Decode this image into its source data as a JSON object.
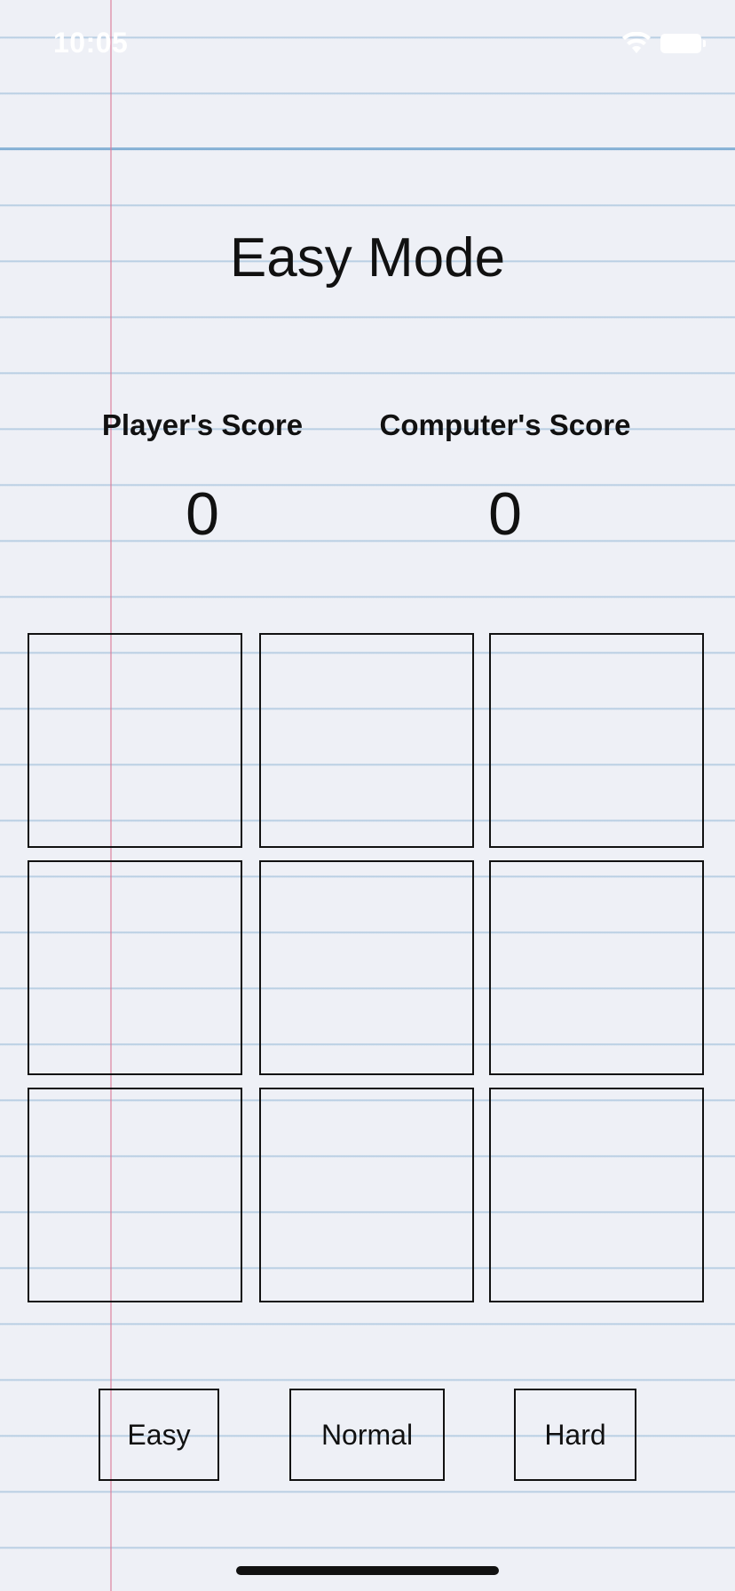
{
  "status_bar": {
    "time": "10:05",
    "wifi_icon": "wifi-icon",
    "battery_icon": "battery-icon"
  },
  "title": "Easy Mode",
  "scores": {
    "player_label": "Player's Score",
    "player_value": "0",
    "computer_label": "Computer's Score",
    "computer_value": "0"
  },
  "board": {
    "cells": [
      "",
      "",
      "",
      "",
      "",
      "",
      "",
      "",
      ""
    ]
  },
  "difficulty": {
    "easy_label": "Easy",
    "normal_label": "Normal",
    "hard_label": "Hard"
  },
  "colors": {
    "ink": "#111111",
    "paper": "#eef0f6",
    "rule_line": "#6ea0c8",
    "margin_line": "#dc7896"
  }
}
